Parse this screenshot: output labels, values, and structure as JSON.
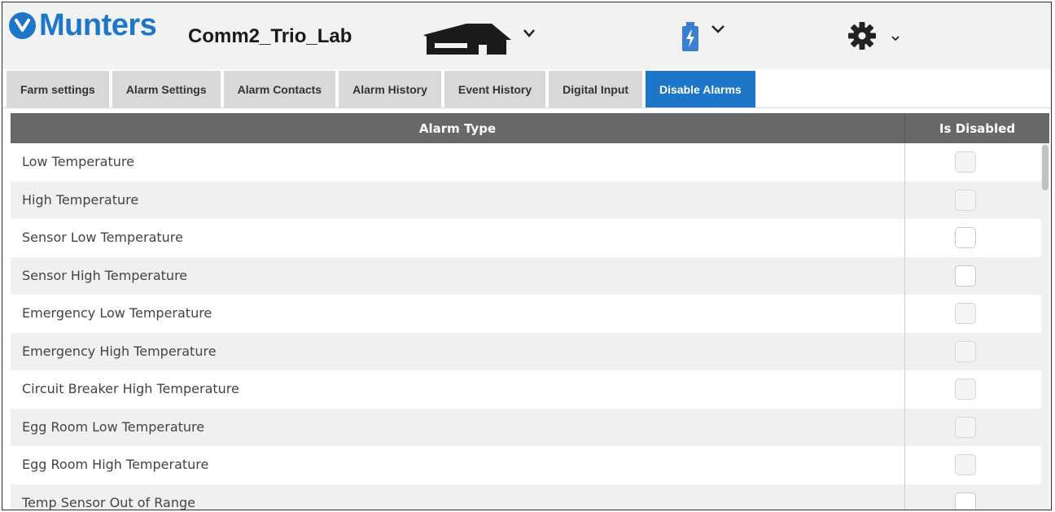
{
  "brand": {
    "name": "Munters",
    "color": "#1e76c8"
  },
  "header": {
    "farm_name": "Comm2_Trio_Lab"
  },
  "icons": [
    "munters-logo-icon",
    "house-icon",
    "battery-icon",
    "gear-icon",
    "chevron-down-icon"
  ],
  "tabs": [
    {
      "label": "Farm settings",
      "active": false
    },
    {
      "label": "Alarm Settings",
      "active": false
    },
    {
      "label": "Alarm Contacts",
      "active": false
    },
    {
      "label": "Alarm History",
      "active": false
    },
    {
      "label": "Event History",
      "active": false
    },
    {
      "label": "Digital Input",
      "active": false
    },
    {
      "label": "Disable Alarms",
      "active": true
    }
  ],
  "table": {
    "columns": {
      "type": "Alarm Type",
      "disabled": "Is Disabled"
    },
    "rows": [
      {
        "label": "Low Temperature",
        "checked": false,
        "enabled": false
      },
      {
        "label": "High Temperature",
        "checked": false,
        "enabled": false
      },
      {
        "label": "Sensor Low Temperature",
        "checked": false,
        "enabled": true
      },
      {
        "label": "Sensor High Temperature",
        "checked": false,
        "enabled": true
      },
      {
        "label": "Emergency Low Temperature",
        "checked": false,
        "enabled": false
      },
      {
        "label": "Emergency High Temperature",
        "checked": false,
        "enabled": false
      },
      {
        "label": "Circuit Breaker High Temperature",
        "checked": false,
        "enabled": false
      },
      {
        "label": "Egg Room Low Temperature",
        "checked": false,
        "enabled": false
      },
      {
        "label": "Egg Room High Temperature",
        "checked": false,
        "enabled": false
      },
      {
        "label": "Temp Sensor Out of Range",
        "checked": false,
        "enabled": true
      }
    ]
  }
}
